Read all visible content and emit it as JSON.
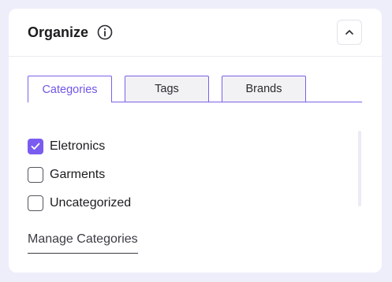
{
  "panel": {
    "title": "Organize",
    "collapse_icon": "chevron-up-icon",
    "info_icon": "info-icon"
  },
  "tabs": [
    {
      "label": "Categories",
      "active": true
    },
    {
      "label": "Tags",
      "active": false
    },
    {
      "label": "Brands",
      "active": false
    }
  ],
  "categories": [
    {
      "label": "Eletronics",
      "checked": true
    },
    {
      "label": "Garments",
      "checked": false
    },
    {
      "label": "Uncategorized",
      "checked": false
    }
  ],
  "manage_link": "Manage Categories",
  "colors": {
    "accent": "#7b5cf0",
    "background": "#eeeefb"
  }
}
